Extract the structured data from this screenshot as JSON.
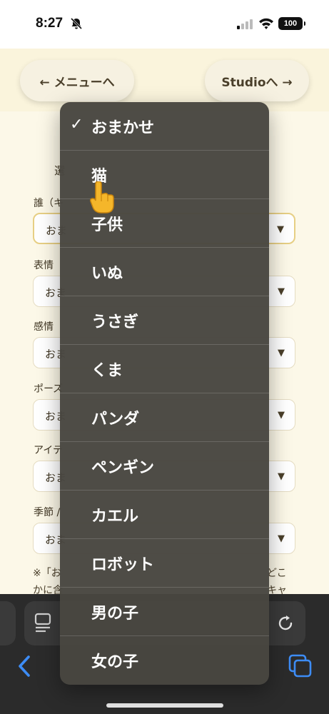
{
  "status_bar": {
    "time": "8:27",
    "battery": "100"
  },
  "nav": {
    "menu_button": "← メニューへ",
    "studio_button": "Studioへ →"
  },
  "form": {
    "peek_heading": "選",
    "fields": [
      {
        "label": "誰（キ",
        "value": "おま",
        "arrow": "▼"
      },
      {
        "label": "表情",
        "value": "おま",
        "arrow": "▼"
      },
      {
        "label": "感情",
        "value": "おま",
        "arrow": "▼"
      },
      {
        "label": "ポーズ",
        "value": "おま",
        "arrow": "▼"
      },
      {
        "label": "アイテ",
        "value": "おま",
        "arrow": "▼"
      },
      {
        "label": "季節 /",
        "value": "おま",
        "arrow": "▼"
      }
    ],
    "note_line1_left": "※「お",
    "note_line1_right": "どこ",
    "note_line2_left": "かに含",
    "note_line2_right": "キャ"
  },
  "dropdown": {
    "checkmark": "✓",
    "options": [
      "おまかせ",
      "猫",
      "子供",
      "いぬ",
      "うさぎ",
      "くま",
      "パンダ",
      "ペンギン",
      "カエル",
      "ロボット",
      "男の子",
      "女の子"
    ],
    "selected_index": 0
  },
  "icons": {
    "status": [
      "bell-slash-icon",
      "signal-icon",
      "wifi-icon",
      "battery-icon"
    ],
    "browser": [
      "reader-icon",
      "reload-icon",
      "back-chevron-icon",
      "tabs-icon"
    ],
    "overlay": [
      "pointing-hand-icon"
    ]
  },
  "colors": {
    "page_bg": "#faf4dc",
    "dropdown_bg": "#484640",
    "focus_border": "#e7cf84",
    "browser_bar": "#2b2b2b",
    "accent_blue": "#3d8cf5"
  }
}
